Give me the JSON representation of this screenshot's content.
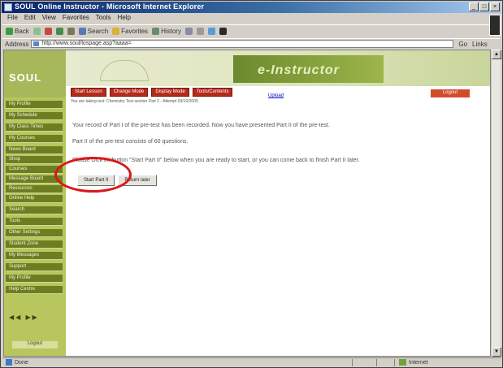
{
  "window": {
    "title": "SOUL Online Instructor - Microsoft Internet Explorer",
    "controls": [
      "_",
      "□",
      "×"
    ]
  },
  "menu": [
    "File",
    "Edit",
    "View",
    "Favorites",
    "Tools",
    "Help"
  ],
  "toolbar": {
    "back": "Back",
    "search": "Search",
    "favorites": "Favorites",
    "history": "History"
  },
  "address": {
    "label": "Address",
    "url": "http://www.soul/lospage.asp?aaaa=",
    "go": "Go",
    "links": "Links"
  },
  "site": {
    "logo": "SOUL",
    "banner": "e-Instructor",
    "sidebar": [
      "My Profile",
      "My Schedule",
      "My Class Times",
      "My Courses",
      "News Board",
      "Shop",
      "Courses",
      "Message Board",
      "Resources",
      "Online Help",
      "Search",
      "Tools",
      "Other Settings",
      "Student Zone",
      "My Messages",
      "Support",
      "My Profile",
      "Help Centre"
    ],
    "sidebar_arrows": "◀◀  ▶▶",
    "sidebar_logout": "Logout",
    "nav": [
      "Start Lesson",
      "Change Mode",
      "Display Mode",
      "Tools/Contents"
    ],
    "nav_link": "Upload",
    "logout": "Logout",
    "subline": "You are taking test: Chemistry Test section Part 2 - Attempt 03/10/2005"
  },
  "content": {
    "line1": "Your record of Part I of the pre-test has been recorded. Now you have presented Part II of the pre-test.",
    "line2": "Part II of the pre-test consists of 60 questions.",
    "line3": "Please click on button \"Start Part II\" below when you are ready to start, or you can come back to finish Part II later.",
    "start_button": "Start Part II",
    "return_button": "Return later"
  },
  "status": {
    "left": "Done",
    "right": "Internet"
  },
  "colors": {
    "highlight": "#d81818",
    "nav_button": "#b32b1a",
    "sidebar": "#6d7e22"
  }
}
